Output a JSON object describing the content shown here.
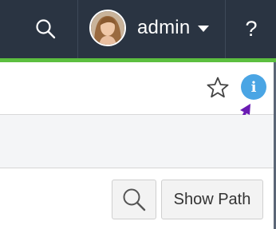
{
  "header": {
    "username": "admin",
    "help_label": "?",
    "icons": {
      "search": "search-icon",
      "caret": "caret-down-icon",
      "avatar": "user-avatar"
    }
  },
  "toolbar": {
    "icons": {
      "star": "star-outline-icon",
      "info": "info-icon"
    },
    "info_glyph": "i"
  },
  "actions": {
    "show_path_label": "Show Path",
    "icons": {
      "search": "search-icon"
    }
  },
  "colors": {
    "topbar": "#2a3442",
    "accent_green": "#5cbf3f",
    "info_blue": "#4aa5e4",
    "annotation_arrow": "#6a1bb3"
  }
}
